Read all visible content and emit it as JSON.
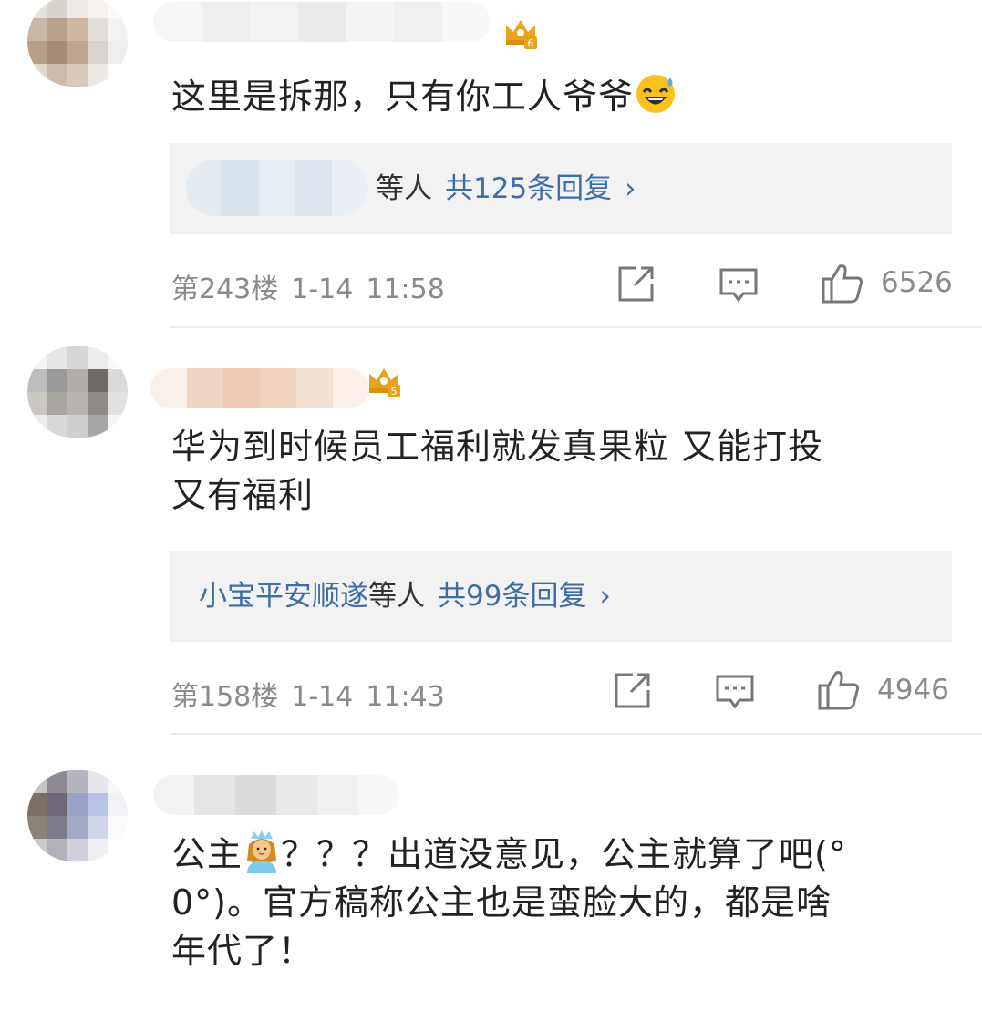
{
  "comments": [
    {
      "text": "这里是拆那，只有你工人爷爷",
      "emoji": "grinning-sweat",
      "crown_level": "6",
      "reply_users": "",
      "reply_etc": "等人",
      "reply_count": "共125条回复",
      "floor": "第243楼",
      "date": "1-14",
      "time": "11:58",
      "likes": "6526"
    },
    {
      "text_line1": "华为到时候员工福利就发真果粒 又能打投",
      "text_line2": "又有福利",
      "crown_level": "5",
      "reply_users": "小宝平安顺遂",
      "reply_etc": "等人",
      "reply_count": "共99条回复",
      "floor": "第158楼",
      "date": "1-14",
      "time": "11:43",
      "likes": "4946"
    },
    {
      "text_prefix": "公主",
      "emoji": "princess",
      "text_line1_rest": "？？？出道没意见，公主就算了吧(°",
      "text_line2": "0°)。官方稿称公主也是蛮脸大的，都是啥",
      "text_line3": "年代了！"
    }
  ],
  "reply_chevron": "›",
  "colors": {
    "link": "#3d6da4",
    "meta": "#8a8a8a",
    "reply_bg": "#f2f2f2",
    "crown": "#e8a21c"
  }
}
